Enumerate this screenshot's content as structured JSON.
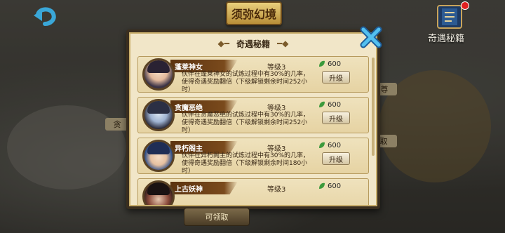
{
  "header": {
    "title": "须弥幻境",
    "corner_label": "奇遇秘籍"
  },
  "dialog": {
    "title": "奇遇秘籍",
    "items": [
      {
        "name": "蓬莱神女",
        "level": "等级3",
        "cost": "600",
        "description": "伙伴在蓬莱神女的试炼过程中有30%的几率，使得奇遇奖励翻倍（下级解锁剩余时间252小时）",
        "button": "升级"
      },
      {
        "name": "贪魔恶绝",
        "level": "等级3",
        "cost": "600",
        "description": "伙伴在贪魔恶绝的试炼过程中有30%的几率，使得奇遇奖励翻倍（下级解锁剩余时间252小时）",
        "button": "升级"
      },
      {
        "name": "异朽阁主",
        "level": "等级3",
        "cost": "600",
        "description": "伙伴在异朽阁主的试炼过程中有30%的几率，使得奇遇奖励翻倍（下级解锁剩余时间180小时）",
        "button": "升级"
      },
      {
        "name": "上古妖神",
        "level": "等级3",
        "cost": "600",
        "description": "",
        "button": ""
      }
    ]
  },
  "background": {
    "label_left": "贪",
    "label_right_top": "尊",
    "label_right_mid": "取",
    "bottom_button": "可领取"
  },
  "colors": {
    "panel": "#f1e6c8",
    "frame": "#3a2e1f",
    "ribbon": "#5b3310",
    "gem": "#3c9a3c"
  }
}
